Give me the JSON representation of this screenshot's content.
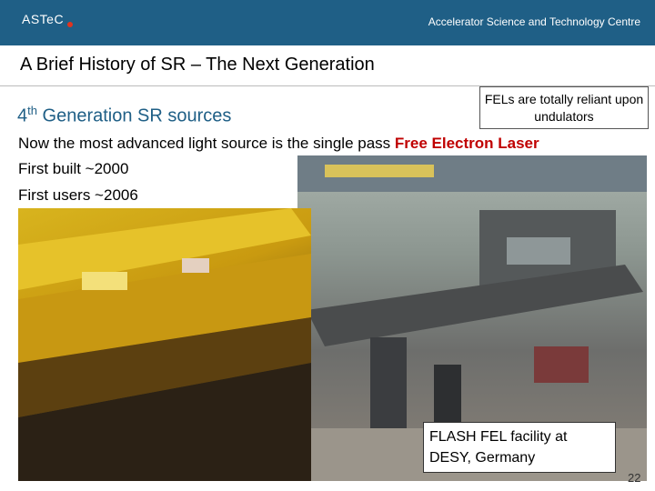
{
  "header": {
    "logo_text": "ASTeC",
    "org_name": "Accelerator Science and Technology Centre"
  },
  "slide": {
    "title": "A Brief History of SR – The Next Generation",
    "subtitle_prefix": "4",
    "subtitle_sup": "th",
    "subtitle_rest": " Generation SR sources",
    "callout": "FELs are totally reliant upon undulators",
    "line1_plain": "Now the most advanced light source is the single pass ",
    "line1_highlight": "Free Electron Laser",
    "line2": "First built ~2000",
    "line3": "First users ~2006",
    "caption": "FLASH FEL facility at DESY, Germany",
    "page_number": "22"
  },
  "colors": {
    "header_bg": "#1f5f86",
    "highlight": "#c00000"
  }
}
